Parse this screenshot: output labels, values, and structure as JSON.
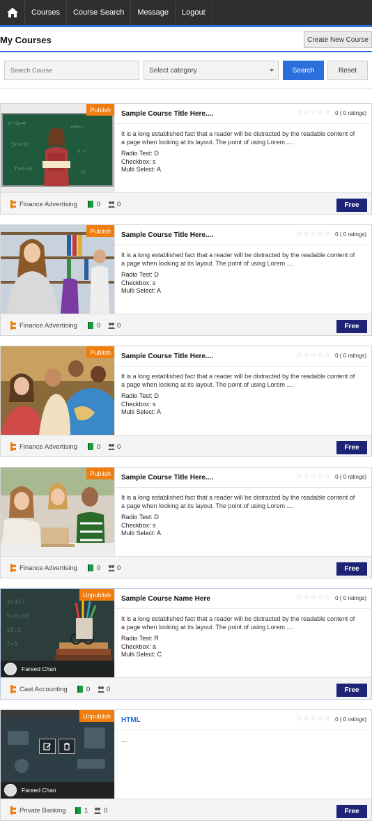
{
  "nav": {
    "home_icon": "home-icon",
    "items": [
      "Courses",
      "Course Search",
      "Message",
      "Logout"
    ]
  },
  "header": {
    "title": "My Courses",
    "create_button": "Create New Course"
  },
  "filters": {
    "search_placeholder": "Search Course",
    "category_selected": "Select category",
    "search_button": "Search",
    "reset_button": "Reset"
  },
  "colors": {
    "accent": "#2a6fdb",
    "nav_bg": "#2f2f2f",
    "badge": "#f07d0e",
    "free_button": "#1d2476"
  },
  "courses": [
    {
      "badge": "Publish",
      "title": "Sample Course Title Here....",
      "rating": "0 ( 0 ratings)",
      "description": "It is a long established fact that a reader will be distracted by the readable content of a page when looking at its layout. The point of using Lorem ....",
      "radio": "Radio Test: D",
      "checkbox": "Checkbox: s",
      "multi": "Multi Select: A",
      "category": "Finance Advertising",
      "lessons": "0",
      "students": "0",
      "price": "Free"
    },
    {
      "badge": "Publish",
      "title": "Sample Course Title Here....",
      "rating": "0 ( 0 ratings)",
      "description": "It is a long established fact that a reader will be distracted by the readable content of a page when looking at its layout. The point of using Lorem ....",
      "radio": "Radio Test: D",
      "checkbox": "Checkbox: s",
      "multi": "Multi Select: A",
      "category": "Finance Advertising",
      "lessons": "0",
      "students": "0",
      "price": "Free"
    },
    {
      "badge": "Publish",
      "title": "Sample Course Title Here....",
      "rating": "0 ( 0 ratings)",
      "description": "It is a long established fact that a reader will be distracted by the readable content of a page when looking at its layout. The point of using Lorem ....",
      "radio": "Radio Test: D",
      "checkbox": "Checkbox: s",
      "multi": "Multi Select: A",
      "category": "Finance Advertising",
      "lessons": "0",
      "students": "0",
      "price": "Free"
    },
    {
      "badge": "Publish",
      "title": "Sample Course Title Here....",
      "rating": "0 ( 0 ratings)",
      "description": "It is a long established fact that a reader will be distracted by the readable content of a page when looking at its layout. The point of using Lorem ....",
      "radio": "Radio Test: D",
      "checkbox": "Checkbox: s",
      "multi": "Multi Select: A",
      "category": "Finance Advertising",
      "lessons": "0",
      "students": "0",
      "price": "Free"
    },
    {
      "badge": "Unpublish",
      "title": "Sample Course Name Here",
      "rating": "0 ( 0 ratings)",
      "description": "It is a long established fact that a reader will be distracted by the readable content of a page when looking at its layout. The point of using Lorem ....",
      "radio": "Radio Test: R",
      "checkbox": "Checkbox: a",
      "multi": "Multi Select: C",
      "author": "Fareed Chan",
      "category": "Cast Accounting",
      "lessons": "0",
      "students": "0",
      "price": "Free"
    },
    {
      "badge": "Unpublish",
      "title": "HTML",
      "rating": "0 ( 0 ratings)",
      "description": "....",
      "author": "Fareed Chan",
      "category": "Private Banking",
      "lessons": "1",
      "students": "0",
      "price": "Free"
    }
  ]
}
